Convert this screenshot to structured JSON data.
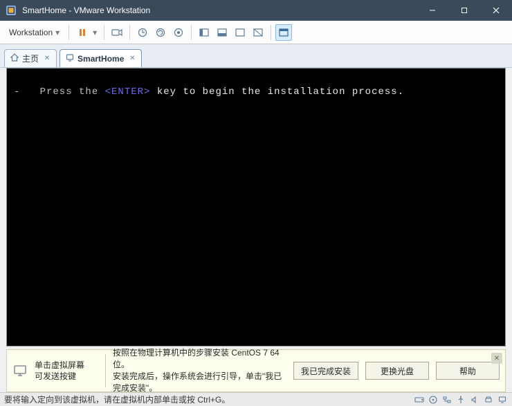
{
  "titlebar": {
    "title": "SmartHome - VMware Workstation"
  },
  "toolbar": {
    "workstation_label": "Workstation"
  },
  "tabs": {
    "home_label": "主页",
    "vm_label": "SmartHome"
  },
  "console": {
    "prefix": "-   Press the ",
    "enter": "<ENTER>",
    "suffix": " key to begin the installation process."
  },
  "info_bar": {
    "left_line1": "单击虚拟屏幕",
    "left_line2": "可发送按键",
    "message": "按照在物理计算机中的步骤安装 CentOS 7 64 位。\n安装完成后，操作系统会进行引导，单击\"我已完成安装\"。",
    "btn_done": "我已完成安装",
    "btn_change": "更换光盘",
    "btn_help": "帮助"
  },
  "status_bar": {
    "message": "要将输入定向到该虚拟机，请在虚拟机内部单击或按 Ctrl+G。"
  },
  "watermark": ""
}
